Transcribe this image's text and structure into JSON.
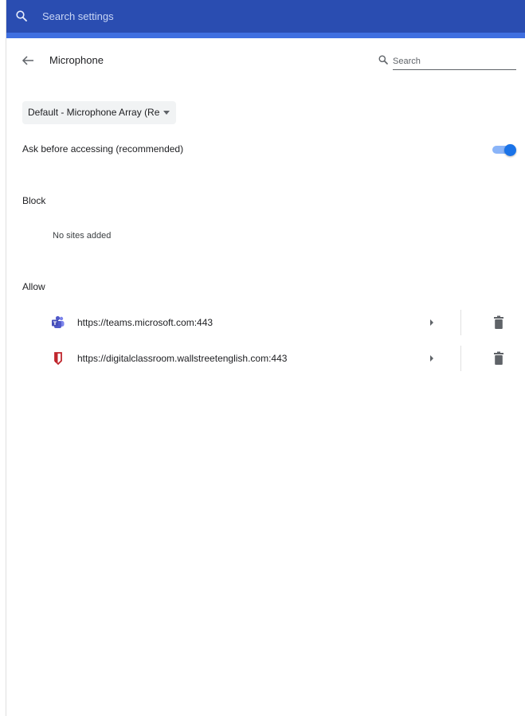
{
  "topbar": {
    "search_placeholder": "Search settings",
    "icon": "search-icon",
    "color": "#2a4db1"
  },
  "header": {
    "back_icon": "arrow-left-icon",
    "title": "Microphone",
    "search_placeholder": "Search"
  },
  "device_select": {
    "selected": "Default - Microphone Array (Re"
  },
  "ask_setting": {
    "label": "Ask before accessing (recommended)",
    "enabled": true,
    "accent": "#1a73e8"
  },
  "block": {
    "heading": "Block",
    "empty_text": "No sites added"
  },
  "allow": {
    "heading": "Allow",
    "sites": [
      {
        "url": "https://teams.microsoft.com:443",
        "icon": "teams-icon"
      },
      {
        "url": "https://digitalclassroom.wallstreetenglish.com:443",
        "icon": "wse-shield-icon"
      }
    ]
  }
}
